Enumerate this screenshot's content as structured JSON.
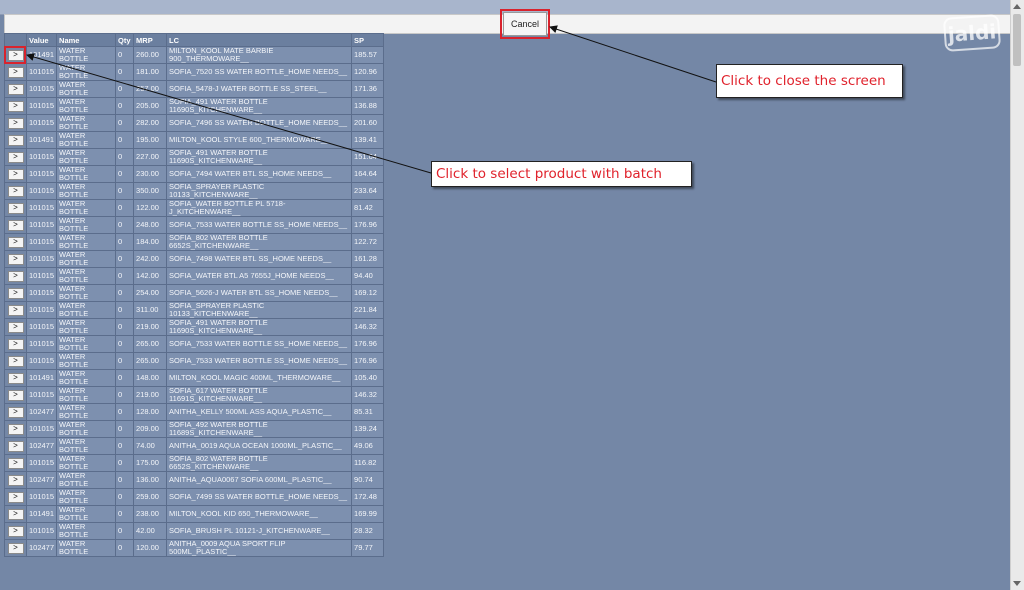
{
  "header": {
    "cancel_label": "Cancel",
    "watermark_text": "jaldi"
  },
  "table": {
    "columns": [
      "",
      "Value",
      "Name",
      "Qty",
      "MRP",
      "LC",
      "SP"
    ],
    "select_label": ">",
    "rows": [
      [
        "101491",
        "WATER BOTTLE",
        "0",
        "260.00",
        "MILTON_KOOL MATE BARBIE 900_THERMOWARE__",
        "185.57"
      ],
      [
        "101015",
        "WATER BOTTLE",
        "0",
        "181.00",
        "SOFIA_7520 SS WATER BOTTLE_HOME NEEDS__",
        "120.96"
      ],
      [
        "101015",
        "WATER BOTTLE",
        "0",
        "257.00",
        "SOFIA_5478-J WATER BOTTLE SS_STEEL__",
        "171.36"
      ],
      [
        "101015",
        "WATER BOTTLE",
        "0",
        "205.00",
        "SOFIA_491 WATER BOTTLE 11690S_KITCHENWARE__",
        "136.88"
      ],
      [
        "101015",
        "WATER BOTTLE",
        "0",
        "282.00",
        "SOFIA_7496 SS WATER BOTTLE_HOME NEEDS__",
        "201.60"
      ],
      [
        "101491",
        "WATER BOTTLE",
        "0",
        "195.00",
        "MILTON_KOOL STYLE 600_THERMOWARE__",
        "139.41"
      ],
      [
        "101015",
        "WATER BOTTLE",
        "0",
        "227.00",
        "SOFIA_491 WATER BOTTLE 11690S_KITCHENWARE__",
        "151.04"
      ],
      [
        "101015",
        "WATER BOTTLE",
        "0",
        "230.00",
        "SOFIA_7494 WATER BTL SS_HOME NEEDS__",
        "164.64"
      ],
      [
        "101015",
        "WATER BOTTLE",
        "0",
        "350.00",
        "SOFIA_SPRAYER PLASTIC 10133_KITCHENWARE__",
        "233.64"
      ],
      [
        "101015",
        "WATER BOTTLE",
        "0",
        "122.00",
        "SOFIA_WATER BOTTLE PL 5718-J_KITCHENWARE__",
        "81.42"
      ],
      [
        "101015",
        "WATER BOTTLE",
        "0",
        "248.00",
        "SOFIA_7533 WATER BOTTLE SS_HOME NEEDS__",
        "176.96"
      ],
      [
        "101015",
        "WATER BOTTLE",
        "0",
        "184.00",
        "SOFIA_802 WATER BOTTLE 6652S_KITCHENWARE__",
        "122.72"
      ],
      [
        "101015",
        "WATER BOTTLE",
        "0",
        "242.00",
        "SOFIA_7498 WATER BTL SS_HOME NEEDS__",
        "161.28"
      ],
      [
        "101015",
        "WATER BOTTLE",
        "0",
        "142.00",
        "SOFIA_WATER BTL A5 7655J_HOME NEEDS__",
        "94.40"
      ],
      [
        "101015",
        "WATER BOTTLE",
        "0",
        "254.00",
        "SOFIA_5626-J WATER BTL SS_HOME NEEDS__",
        "169.12"
      ],
      [
        "101015",
        "WATER BOTTLE",
        "0",
        "311.00",
        "SOFIA_SPRAYER PLASTIC 10133_KITCHENWARE__",
        "221.84"
      ],
      [
        "101015",
        "WATER BOTTLE",
        "0",
        "219.00",
        "SOFIA_491 WATER BOTTLE 11690S_KITCHENWARE__",
        "146.32"
      ],
      [
        "101015",
        "WATER BOTTLE",
        "0",
        "265.00",
        "SOFIA_7533 WATER BOTTLE SS_HOME NEEDS__",
        "176.96"
      ],
      [
        "101015",
        "WATER BOTTLE",
        "0",
        "265.00",
        "SOFIA_7533 WATER BOTTLE SS_HOME NEEDS__",
        "176.96"
      ],
      [
        "101491",
        "WATER BOTTLE",
        "0",
        "148.00",
        "MILTON_KOOL MAGIC 400ML_THERMOWARE__",
        "105.40"
      ],
      [
        "101015",
        "WATER BOTTLE",
        "0",
        "219.00",
        "SOFIA_617 WATER BOTTLE 11691S_KITCHENWARE__",
        "146.32"
      ],
      [
        "102477",
        "WATER BOTTLE",
        "0",
        "128.00",
        "ANITHA_KELLY 500ML ASS AQUA_PLASTIC__",
        "85.31"
      ],
      [
        "101015",
        "WATER BOTTLE",
        "0",
        "209.00",
        "SOFIA_492 WATER BOTTLE 11689S_KITCHENWARE__",
        "139.24"
      ],
      [
        "102477",
        "WATER BOTTLE",
        "0",
        "74.00",
        "ANITHA_0019 AQUA OCEAN 1000ML_PLASTIC__",
        "49.06"
      ],
      [
        "101015",
        "WATER BOTTLE",
        "0",
        "175.00",
        "SOFIA_802 WATER BOTTLE 6652S_KITCHENWARE__",
        "116.82"
      ],
      [
        "102477",
        "WATER BOTTLE",
        "0",
        "136.00",
        "ANITHA_AQUA0067 SOFIA 600ML_PLASTIC__",
        "90.74"
      ],
      [
        "101015",
        "WATER BOTTLE",
        "0",
        "259.00",
        "SOFIA_7499 SS WATER BOTTLE_HOME NEEDS__",
        "172.48"
      ],
      [
        "101491",
        "WATER BOTTLE",
        "0",
        "238.00",
        "MILTON_KOOL KID 650_THERMOWARE__",
        "169.99"
      ],
      [
        "101015",
        "WATER BOTTLE",
        "0",
        "42.00",
        "SOFIA_BRUSH PL 10121-J_KITCHENWARE__",
        "28.32"
      ],
      [
        "102477",
        "WATER BOTTLE",
        "0",
        "120.00",
        "ANITHA_0009 AQUA SPORT FLIP 500ML_PLASTIC__",
        "79.77"
      ]
    ]
  },
  "callouts": {
    "close": "Click to close the screen",
    "select": "Click to select product with batch"
  },
  "colors": {
    "accent_red": "#d9232d",
    "callout_text": "#e0222c"
  }
}
